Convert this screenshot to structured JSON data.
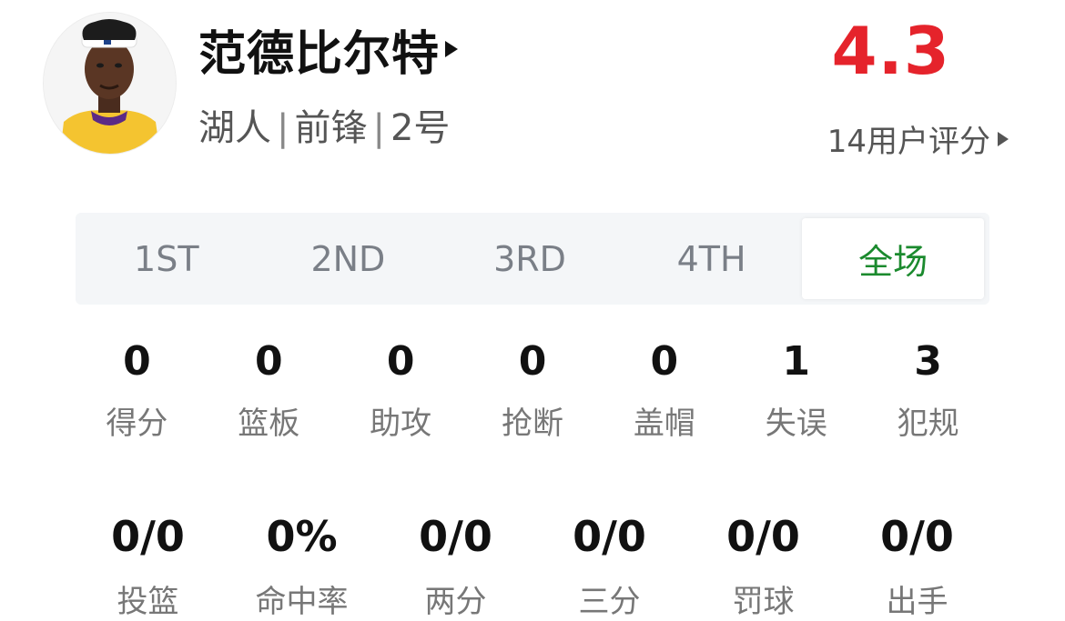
{
  "player": {
    "name": "范德比尔特",
    "team": "湖人",
    "position": "前锋",
    "number": "2号",
    "separator": "|"
  },
  "rating": {
    "score": "4.3",
    "count_text": "14用户评分",
    "color": "#e5232b"
  },
  "tabs": [
    {
      "label": "1ST",
      "active": false
    },
    {
      "label": "2ND",
      "active": false
    },
    {
      "label": "3RD",
      "active": false
    },
    {
      "label": "4TH",
      "active": false
    },
    {
      "label": "全场",
      "active": true
    }
  ],
  "accent_color": "#1b8a2e",
  "stats": [
    {
      "value": "0",
      "label": "得分"
    },
    {
      "value": "0",
      "label": "篮板"
    },
    {
      "value": "0",
      "label": "助攻"
    },
    {
      "value": "0",
      "label": "抢断"
    },
    {
      "value": "0",
      "label": "盖帽"
    },
    {
      "value": "1",
      "label": "失误"
    },
    {
      "value": "3",
      "label": "犯规"
    }
  ],
  "shooting": [
    {
      "value": "0/0",
      "label": "投篮"
    },
    {
      "value": "0%",
      "label": "命中率"
    },
    {
      "value": "0/0",
      "label": "两分"
    },
    {
      "value": "0/0",
      "label": "三分"
    },
    {
      "value": "0/0",
      "label": "罚球"
    },
    {
      "value": "0/0",
      "label": "出手"
    }
  ],
  "icons": {
    "avatar": "player-headshot",
    "name_arrow": "play-triangle-icon",
    "rating_arrow": "play-triangle-icon"
  }
}
